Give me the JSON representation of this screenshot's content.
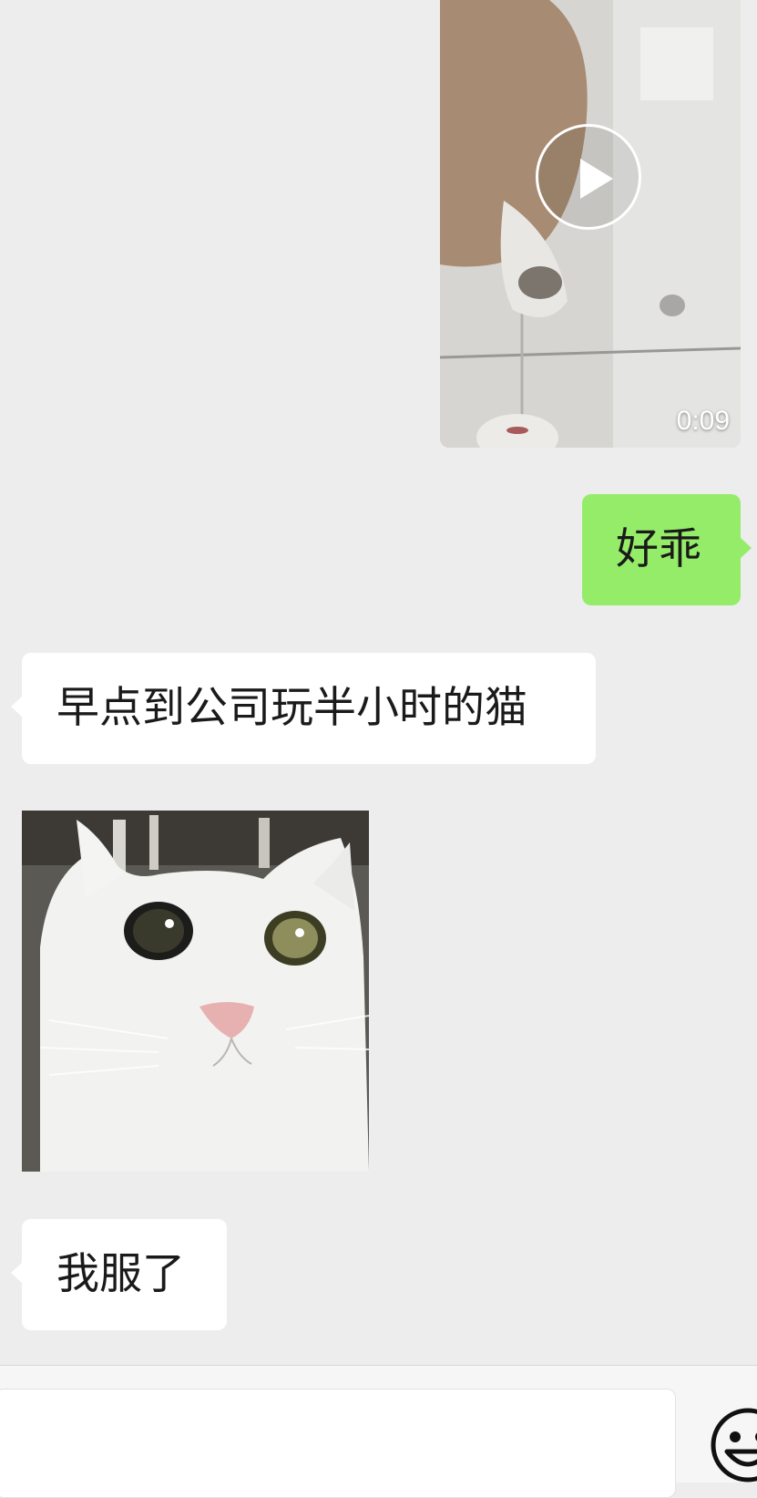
{
  "chat": {
    "video": {
      "duration": "0:09",
      "play_icon": "play-icon"
    },
    "messages": [
      {
        "direction": "outgoing",
        "text": "好乖"
      },
      {
        "direction": "incoming",
        "text": "早点到公司玩半小时的猫"
      },
      {
        "direction": "incoming",
        "type": "image",
        "description_icon": "white-cat-image"
      },
      {
        "direction": "incoming",
        "text": "我服了"
      }
    ]
  },
  "input_bar": {
    "text_value": "",
    "emoji_icon": "emoji-icon"
  },
  "colors": {
    "background": "#ededed",
    "outgoing_bubble": "#95ec69",
    "incoming_bubble": "#ffffff"
  }
}
